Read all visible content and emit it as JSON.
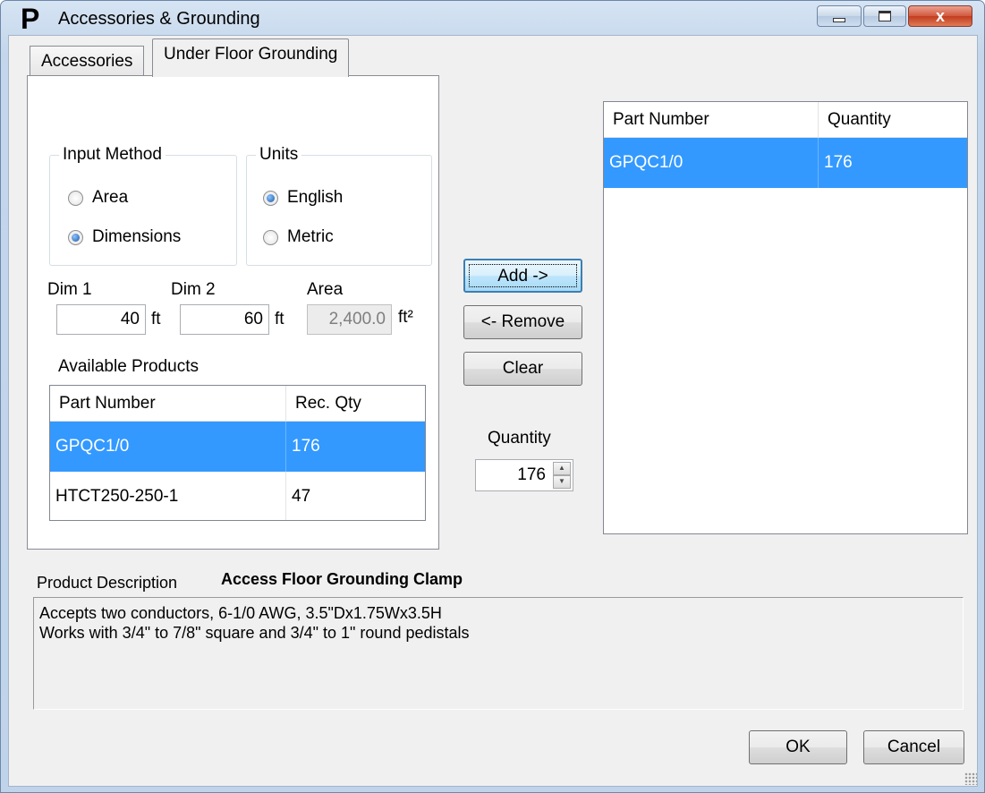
{
  "window": {
    "title": "Accessories & Grounding",
    "app_icon_letter": "P",
    "controls": {
      "minimize": "minimize-icon",
      "maximize": "maximize-icon",
      "close": "close-icon",
      "close_glyph": "x"
    }
  },
  "tabs": [
    {
      "label": "Accessories",
      "active": false
    },
    {
      "label": "Under Floor Grounding",
      "active": true
    }
  ],
  "input_method": {
    "title": "Input Method",
    "options": [
      {
        "label": "Area",
        "selected": false
      },
      {
        "label": "Dimensions",
        "selected": true
      }
    ]
  },
  "units": {
    "title": "Units",
    "options": [
      {
        "label": "English",
        "selected": true
      },
      {
        "label": "Metric",
        "selected": false
      }
    ]
  },
  "dimensions": {
    "dim1_label": "Dim 1",
    "dim1_value": "40",
    "dim1_unit": "ft",
    "dim2_label": "Dim 2",
    "dim2_value": "60",
    "dim2_unit": "ft",
    "area_label": "Area",
    "area_value": "2,400.0",
    "area_unit": "ft²"
  },
  "available_products": {
    "title": "Available Products",
    "columns": [
      "Part Number",
      "Rec. Qty"
    ],
    "rows": [
      {
        "part": "GPQC1/0",
        "qty": "176",
        "selected": true
      },
      {
        "part": "HTCT250-250-1",
        "qty": "47",
        "selected": false
      }
    ]
  },
  "buttons": {
    "add": "Add ->",
    "remove": "<- Remove",
    "clear": "Clear",
    "ok": "OK",
    "cancel": "Cancel"
  },
  "quantity": {
    "label": "Quantity",
    "value": "176"
  },
  "selected_products": {
    "columns": [
      "Part Number",
      "Quantity"
    ],
    "rows": [
      {
        "part": "GPQC1/0",
        "qty": "176",
        "selected": true
      }
    ]
  },
  "description": {
    "label": "Product Description",
    "title": "Access Floor Grounding Clamp",
    "line1": "Accepts two conductors, 6-1/0 AWG, 3.5\"Dx1.75Wx3.5H",
    "line2": "Works with 3/4\" to 7/8\" square and 3/4\" to 1\" round pedistals"
  },
  "colors": {
    "selection": "#3399ff",
    "window_frame": "#c4d6ec"
  }
}
